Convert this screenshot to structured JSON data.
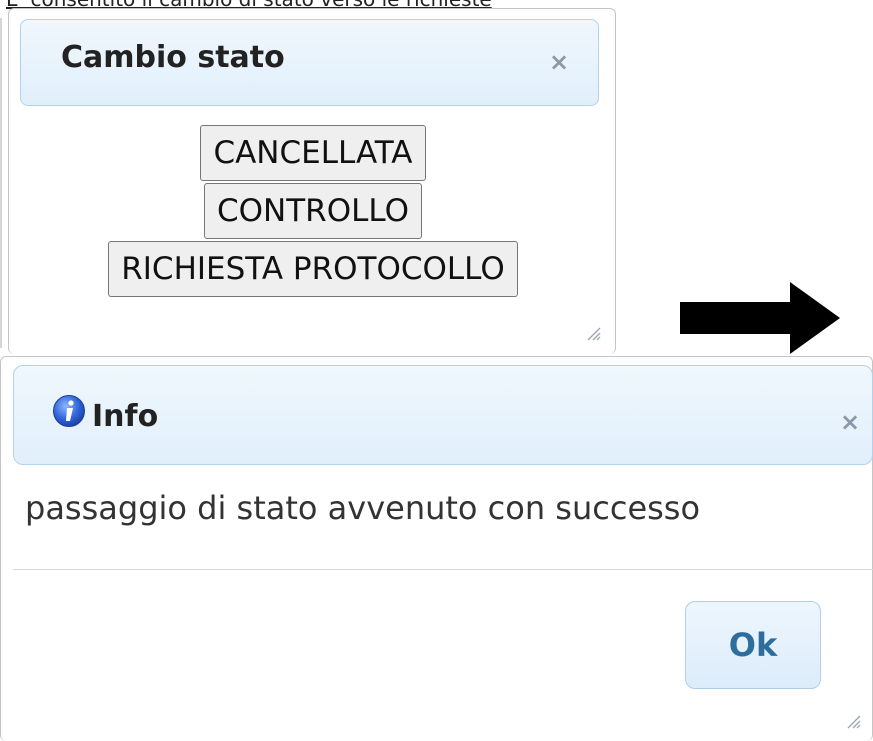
{
  "page": {
    "top_caption": "E' consentito il cambio di stato verso le richieste"
  },
  "cambio_stato_dialog": {
    "title": "Cambio stato",
    "close_label": "×",
    "states": [
      "CANCELLATA",
      "CONTROLLO",
      "RICHIESTA PROTOCOLLO"
    ]
  },
  "info_dialog": {
    "title": "Info",
    "icon": "info-icon",
    "close_label": "×",
    "message": "passaggio di stato avvenuto con successo",
    "ok_label": "Ok"
  },
  "colors": {
    "header_bg": "#e1effb",
    "header_border": "#b2d2ec",
    "ok_text": "#2e6e9e",
    "arrow": "#000000"
  }
}
